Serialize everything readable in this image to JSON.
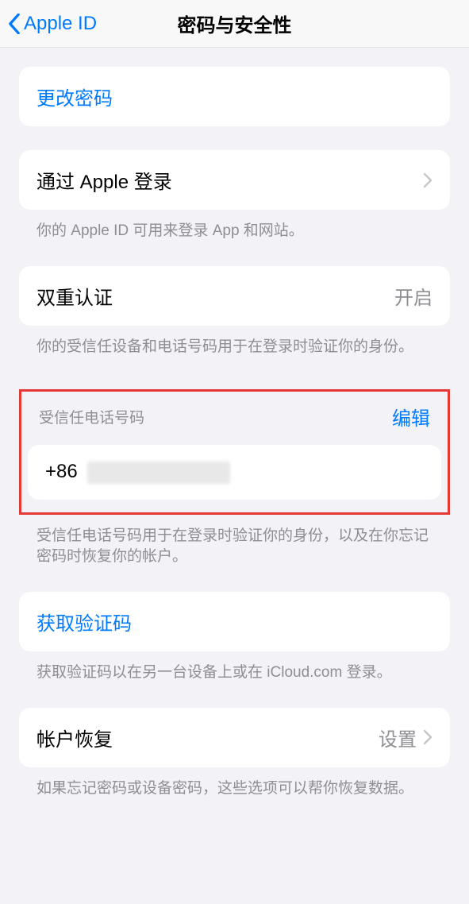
{
  "header": {
    "back_label": "Apple ID",
    "title": "密码与安全性"
  },
  "groups": {
    "change_password": {
      "label": "更改密码"
    },
    "sign_in_with_apple": {
      "label": "通过 Apple 登录",
      "footer": "你的 Apple ID 可用来登录 App 和网站。"
    },
    "two_factor": {
      "label": "双重认证",
      "value": "开启",
      "footer": "你的受信任设备和电话号码用于在登录时验证你的身份。"
    },
    "trusted_phone": {
      "header_label": "受信任电话号码",
      "header_action": "编辑",
      "number_prefix": "+86",
      "footer": "受信任电话号码用于在登录时验证你的身份，以及在你忘记密码时恢复你的帐户。"
    },
    "get_code": {
      "label": "获取验证码",
      "footer": "获取验证码以在另一台设备上或在 iCloud.com 登录。"
    },
    "account_recovery": {
      "label": "帐户恢复",
      "value": "设置",
      "footer": "如果忘记密码或设备密码，这些选项可以帮你恢复数据。"
    }
  }
}
